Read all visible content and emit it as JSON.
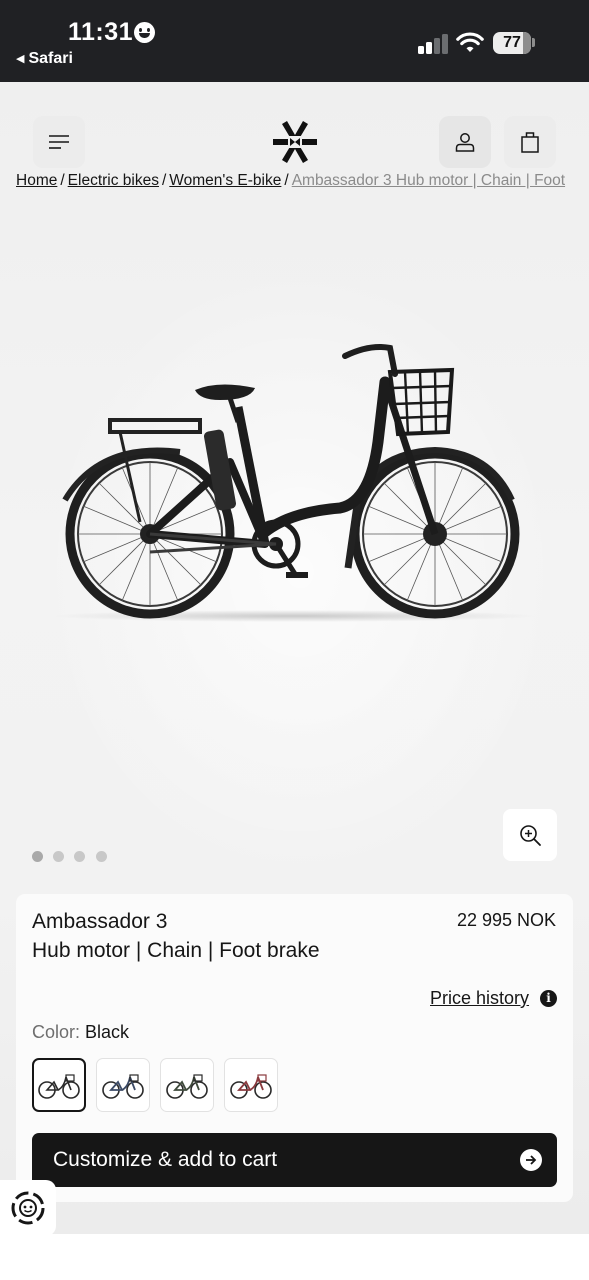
{
  "status_bar": {
    "time": "11:31",
    "back_app": "Safari",
    "battery": "77"
  },
  "header": {
    "menu_icon": "hamburger-menu-icon",
    "logo_icon": "brand-asterisk-logo",
    "account_icon": "user-icon",
    "cart_icon": "shopping-bag-icon"
  },
  "breadcrumb": {
    "items": [
      "Home",
      "Electric bikes",
      "Women's E-bike"
    ],
    "separator": "/",
    "current": "Ambassador 3 Hub motor | Chain | Foot"
  },
  "gallery": {
    "image_label": "black city e-bike with front basket",
    "zoom_icon": "zoom-in-icon",
    "slide_count": 4,
    "active_slide": 1
  },
  "product": {
    "name": "Ambassador 3",
    "variant": "Hub motor | Chain | Foot brake",
    "price": "22 995 NOK",
    "price_history_label": "Price history",
    "info_icon_text": "i",
    "color_label": "Color:",
    "color_value": "Black",
    "swatches": [
      {
        "name": "Black",
        "frame": "#2a2a2a"
      },
      {
        "name": "Navy",
        "frame": "#3b4a66"
      },
      {
        "name": "Green",
        "frame": "#3f4b3c"
      },
      {
        "name": "Red",
        "frame": "#8a3a3e"
      }
    ],
    "cta_label": "Customize & add to cart"
  },
  "colors": {
    "status_bar_bg": "#202124",
    "cta_bg": "#161616",
    "page_bg": "#f0f0f0"
  },
  "widget_icon": "support-widget-icon"
}
